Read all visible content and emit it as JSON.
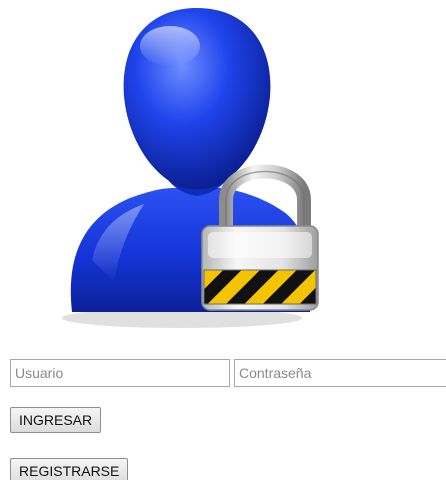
{
  "login_form": {
    "icon": "user-lock-icon",
    "username": {
      "value": "",
      "placeholder": "Usuario"
    },
    "password": {
      "value": "",
      "placeholder": "Contraseña"
    },
    "login_label": "INGRESAR",
    "register_label": "REGISTRARSE"
  },
  "colors": {
    "figure_blue": "#1a3ee8",
    "lock_stripe_yellow": "#f5c400",
    "lock_stripe_black": "#111111"
  }
}
